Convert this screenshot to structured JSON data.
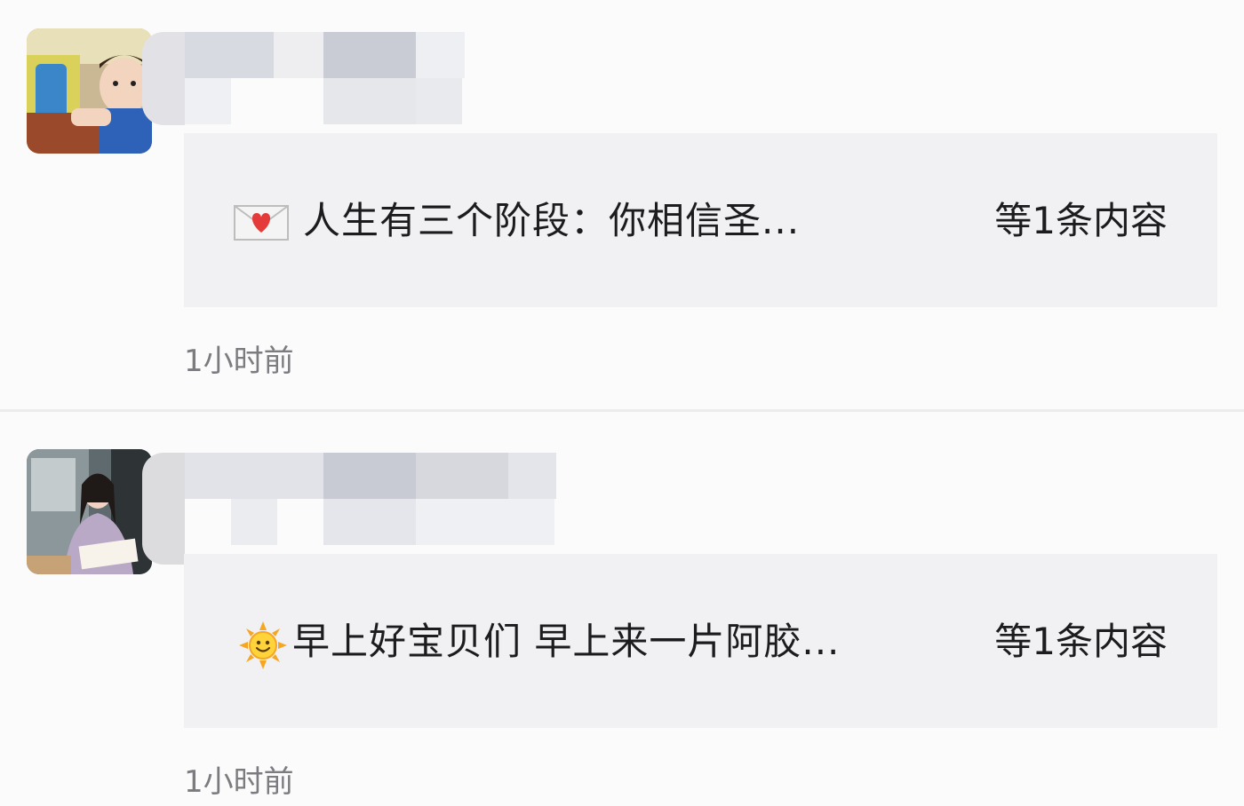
{
  "feed": {
    "posts": [
      {
        "avatar_icon": "avatar-photo-child",
        "card": {
          "emoji_icon": "love-letter-icon",
          "text": "人生有三个阶段：你相信圣...",
          "suffix": "等1条内容"
        },
        "timestamp": "1小时前"
      },
      {
        "avatar_icon": "avatar-photo-woman",
        "card": {
          "emoji_icon": "sun-with-face-icon",
          "text": "早上好宝贝们  早上来一片阿胶...",
          "suffix": "等1条内容"
        },
        "timestamp": "1小时前"
      }
    ]
  },
  "colors": {
    "background": "#fbfbfc",
    "card_background": "#f1f1f4",
    "text_primary": "#1c1c1e",
    "text_secondary": "#7b7b80",
    "divider": "#ececef"
  }
}
